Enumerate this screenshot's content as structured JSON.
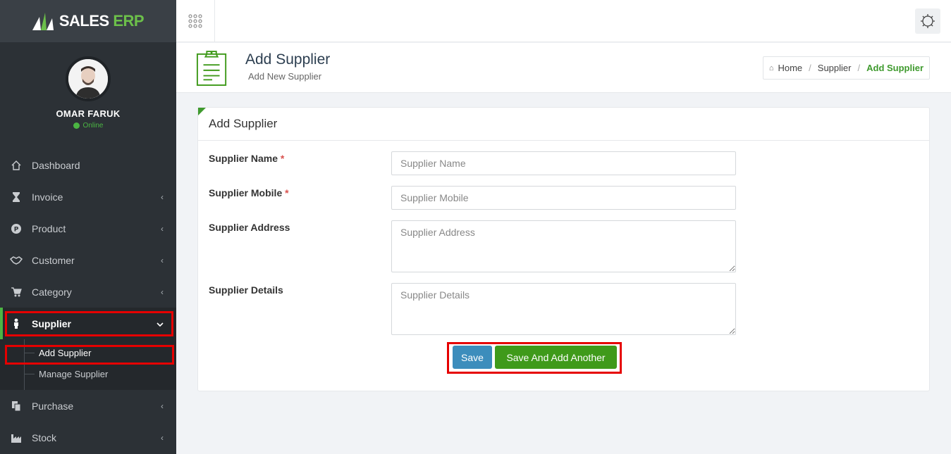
{
  "brand": {
    "name_part1": "SALES",
    "name_part2": "ERP"
  },
  "user": {
    "name": "OMAR FARUK",
    "status": "Online"
  },
  "sidebar": {
    "items": [
      {
        "label": "Dashboard",
        "icon": "home-icon"
      },
      {
        "label": "Invoice",
        "icon": "hourglass-icon"
      },
      {
        "label": "Product",
        "icon": "product-icon"
      },
      {
        "label": "Customer",
        "icon": "handshake-icon"
      },
      {
        "label": "Category",
        "icon": "cart-icon"
      },
      {
        "label": "Supplier",
        "icon": "person-icon"
      },
      {
        "label": "Purchase",
        "icon": "copy-icon"
      },
      {
        "label": "Stock",
        "icon": "factory-icon"
      }
    ],
    "supplier_submenu": [
      {
        "label": "Add Supplier"
      },
      {
        "label": "Manage Supplier"
      }
    ]
  },
  "header": {
    "title": "Add Supplier",
    "subtitle": "Add New Supplier",
    "breadcrumb": {
      "home": "Home",
      "parent": "Supplier",
      "current": "Add Supplier",
      "separator": "/"
    }
  },
  "form": {
    "title": "Add Supplier",
    "required_mark": "*",
    "name_label": "Supplier Name",
    "name_placeholder": "Supplier Name",
    "mobile_label": "Supplier Mobile",
    "mobile_placeholder": "Supplier Mobile",
    "address_label": "Supplier Address",
    "address_placeholder": "Supplier Address",
    "details_label": "Supplier Details",
    "details_placeholder": "Supplier Details",
    "save_label": "Save",
    "save_add_label": "Save And Add Another"
  },
  "colors": {
    "accent_green": "#3f9a1a",
    "save_blue": "#3c8dbc",
    "highlight_red": "#e60000",
    "sidebar_bg": "#2c3136"
  }
}
